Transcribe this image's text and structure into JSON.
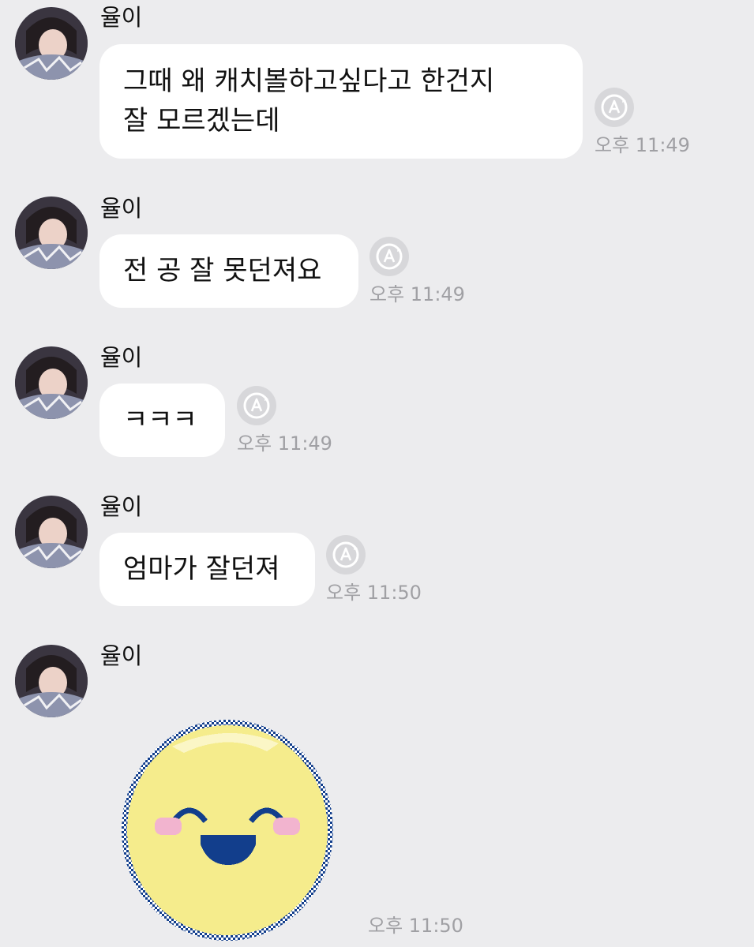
{
  "sender_name": "율이",
  "messages": [
    {
      "text": "그때 왜 캐치볼하고싶다고 한건지\n잘 모르겠는데",
      "time": "오후 11:49"
    },
    {
      "text": "전 공 잘 못던져요",
      "time": "오후 11:49"
    },
    {
      "text": "ㅋㅋㅋ",
      "time": "오후 11:49"
    },
    {
      "text": "엄마가 잘던져",
      "time": "오후 11:50"
    },
    {
      "sticker": "laughing-yellow-pixel-face",
      "time": "오후 11:50"
    }
  ],
  "icons": {
    "translate": "auto-translate-icon",
    "avatar": "profile-photo"
  },
  "colors": {
    "background": "#ececee",
    "bubble": "#ffffff",
    "time_text": "#a0a0a4",
    "sticker_face": "#f5ec8c",
    "sticker_outline": "#123e8c",
    "sticker_blush": "#f2b4cf"
  }
}
